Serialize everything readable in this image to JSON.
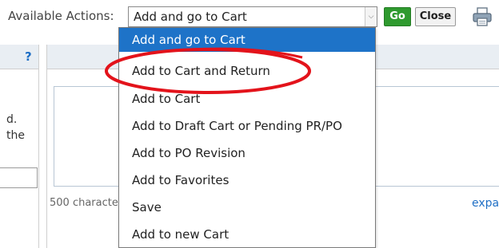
{
  "toolbar": {
    "label": "Available Actions:",
    "selected_value": "Add and go to Cart",
    "go_label": "Go",
    "close_label": "Close",
    "print_icon": "printer-icon"
  },
  "dropdown": {
    "items": [
      "Add and go to Cart",
      "Add to Cart and Return",
      "Add to Cart",
      "Add to Draft Cart or Pending PR/PO",
      "Add to PO Revision",
      "Add to Favorites",
      "Save",
      "Add to new Cart"
    ],
    "selected_index": 0,
    "highlighted_item": "Add to Cart and Return"
  },
  "left_panel": {
    "help": "?",
    "text_line1": "d.",
    "text_line2": "the"
  },
  "main_panel": {
    "char_count": "500 character",
    "expand_link": "expa"
  },
  "colors": {
    "selected_bg": "#1e73c8",
    "go_button": "#2f9a2f",
    "annotation": "#e3131b",
    "header_bg": "#e9eef3",
    "link": "#1f6fc5"
  }
}
